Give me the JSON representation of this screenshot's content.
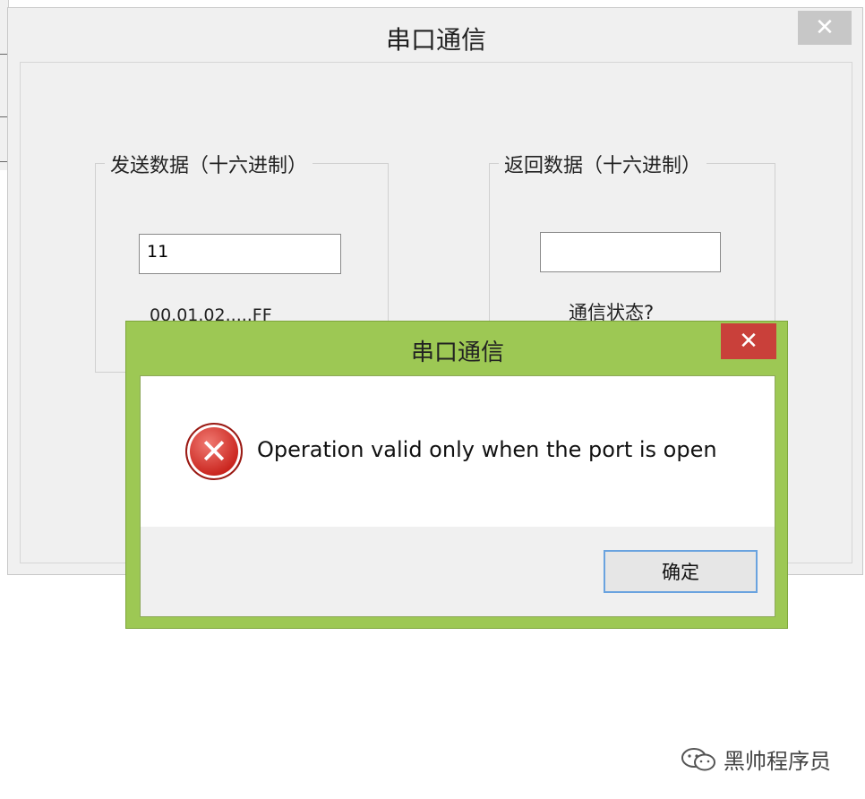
{
  "main_window": {
    "title": "串口通信",
    "close_glyph": "✕",
    "send_group": {
      "label": "发送数据（十六进制）",
      "input_value": "11",
      "hint": "00.01.02.....FF"
    },
    "receive_group": {
      "label": "返回数据（十六进制）",
      "input_value": "",
      "status_label": "通信状态?"
    }
  },
  "dialog": {
    "title": "串口通信",
    "close_glyph": "✕",
    "icon": "error-icon",
    "icon_glyph": "✕",
    "message": "Operation valid only when the port is open",
    "ok_label": "确定",
    "colors": {
      "frame": "#9dc854",
      "close": "#c9403a",
      "ok_border": "#6aa3df"
    }
  },
  "watermark": {
    "icon": "wechat-icon",
    "text": "黑帅程序员"
  }
}
